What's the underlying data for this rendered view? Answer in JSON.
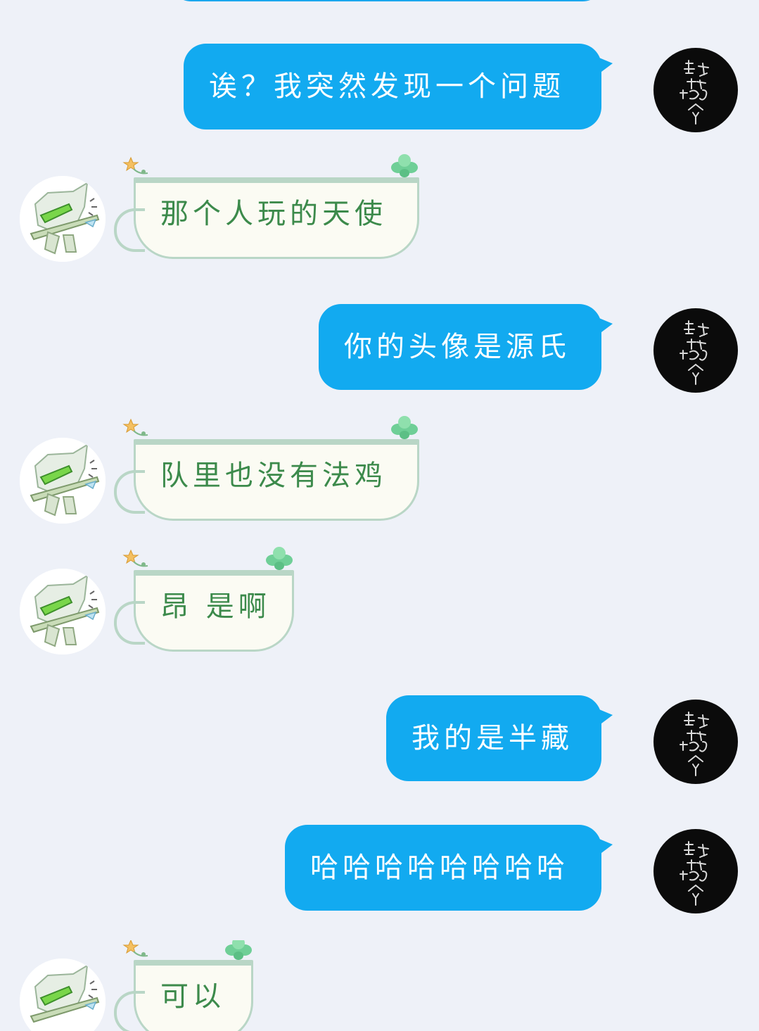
{
  "colors": {
    "background": "#eef1f8",
    "self_bubble": "#12aaf0",
    "self_text": "#ffffff",
    "other_text": "#3c8a4b",
    "cup_border": "#b9d6c6",
    "cup_fill": "#fbfbf3"
  },
  "messages": [
    {
      "side": "self",
      "text": "诶？我突然发现一个问题"
    },
    {
      "side": "other",
      "text": "那个人玩的天使"
    },
    {
      "side": "self",
      "text": "你的头像是源氏"
    },
    {
      "side": "other",
      "text": "队里也没有法鸡"
    },
    {
      "side": "other",
      "text": "昂 是啊"
    },
    {
      "side": "self",
      "text": "我的是半藏"
    },
    {
      "side": "self",
      "text": "哈哈哈哈哈哈哈哈"
    },
    {
      "side": "other",
      "text": "可以"
    }
  ],
  "avatars": {
    "self": {
      "icon": "calligraphy-avatar",
      "text": "龍が我が敵を喰らう"
    },
    "other": {
      "icon": "genji-chibi-avatar"
    }
  },
  "decorations": {
    "cup_flower_icon": "star-flower-icon",
    "cup_leaf_icon": "clover-leaf-icon"
  }
}
